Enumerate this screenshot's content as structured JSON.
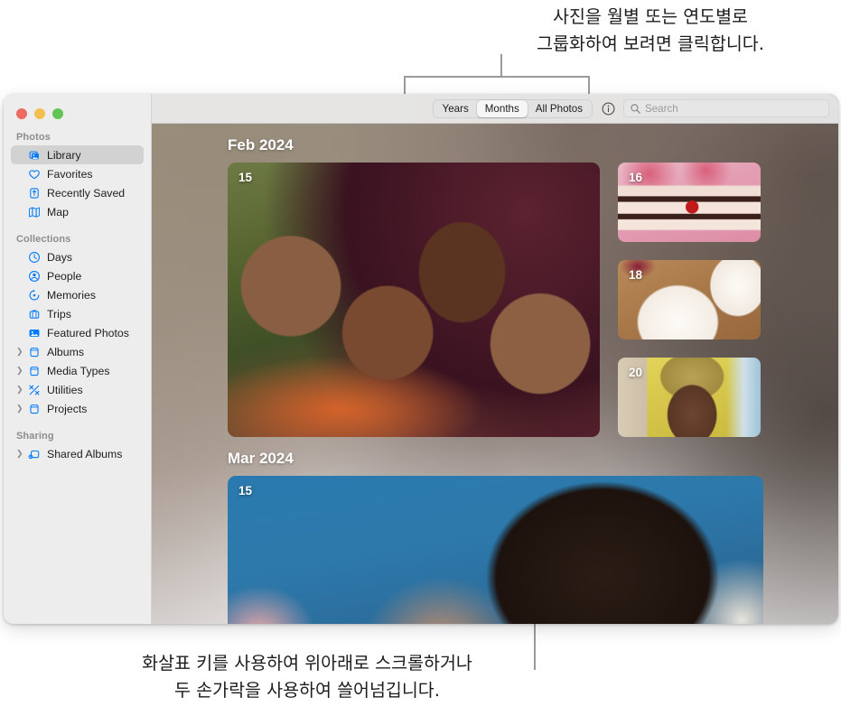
{
  "callouts": {
    "top": "사진을 월별 또는 연도별로\n그룹화하여 보려면 클릭합니다.",
    "bottom": "화살표 키를 사용하여 위아래로 스크롤하거나\n두 손가락을 사용하여 쓸어넘깁니다."
  },
  "window": {
    "traffic_lights": [
      "close",
      "minimize",
      "zoom"
    ]
  },
  "sidebar": {
    "sections": [
      {
        "title": "Photos",
        "items": [
          {
            "label": "Library",
            "icon": "photo-library-icon",
            "selected": true,
            "disclosure": false
          },
          {
            "label": "Favorites",
            "icon": "heart-icon",
            "selected": false,
            "disclosure": false
          },
          {
            "label": "Recently Saved",
            "icon": "recently-saved-icon",
            "selected": false,
            "disclosure": false
          },
          {
            "label": "Map",
            "icon": "map-icon",
            "selected": false,
            "disclosure": false
          }
        ]
      },
      {
        "title": "Collections",
        "items": [
          {
            "label": "Days",
            "icon": "clock-icon",
            "selected": false,
            "disclosure": false
          },
          {
            "label": "People",
            "icon": "person-circle-icon",
            "selected": false,
            "disclosure": false
          },
          {
            "label": "Memories",
            "icon": "memories-icon",
            "selected": false,
            "disclosure": false
          },
          {
            "label": "Trips",
            "icon": "suitcase-icon",
            "selected": false,
            "disclosure": false
          },
          {
            "label": "Featured Photos",
            "icon": "featured-photo-icon",
            "selected": false,
            "disclosure": false
          },
          {
            "label": "Albums",
            "icon": "album-icon",
            "selected": false,
            "disclosure": true
          },
          {
            "label": "Media Types",
            "icon": "album-icon",
            "selected": false,
            "disclosure": true
          },
          {
            "label": "Utilities",
            "icon": "tools-icon",
            "selected": false,
            "disclosure": true
          },
          {
            "label": "Projects",
            "icon": "album-icon",
            "selected": false,
            "disclosure": true
          }
        ]
      },
      {
        "title": "Sharing",
        "items": [
          {
            "label": "Shared Albums",
            "icon": "shared-album-icon",
            "selected": false,
            "disclosure": true
          }
        ]
      }
    ]
  },
  "toolbar": {
    "segments": [
      {
        "label": "Years",
        "active": false
      },
      {
        "label": "Months",
        "active": true
      },
      {
        "label": "All Photos",
        "active": false
      }
    ],
    "info_label": "i",
    "search_placeholder": "Search"
  },
  "library": {
    "months": [
      {
        "title": "Feb 2024",
        "hero": {
          "day": "15",
          "art": "p-group"
        },
        "thumbs": [
          {
            "day": "16",
            "art": "p-cake"
          },
          {
            "day": "18",
            "art": "p-plate"
          },
          {
            "day": "20",
            "art": "p-person"
          }
        ]
      },
      {
        "title": "Mar 2024",
        "hero": {
          "day": "15",
          "art": "p-sleep"
        },
        "thumbs": []
      }
    ]
  },
  "colors": {
    "accent": "#007aff",
    "sidebar_bg": "#ededed",
    "selected_row": "#d2d2d2",
    "leader_line": "#9a9a9a"
  }
}
